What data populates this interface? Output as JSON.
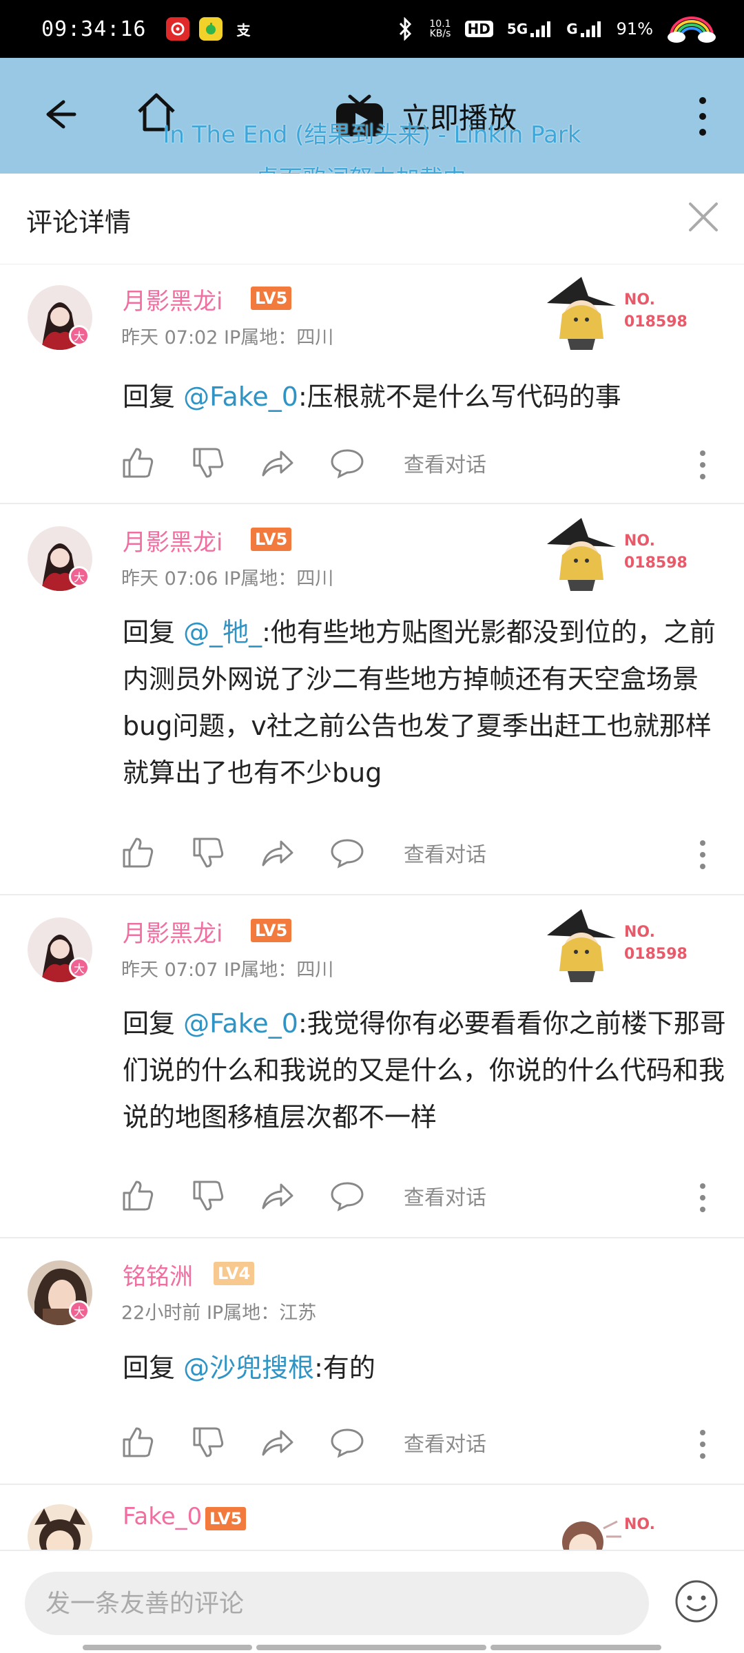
{
  "status_bar": {
    "time": "09:34:16",
    "app_icons": [
      "netease-music-icon",
      "qq-music-icon",
      "alipay-icon"
    ],
    "alipay_glyph": "支",
    "net_speed_top": "10.1",
    "net_speed_bottom": "KB/s",
    "hd": "HD",
    "signal_5g": "5G",
    "signal_g": "G",
    "battery": "91%"
  },
  "app_bar": {
    "play_now_label": "立即播放",
    "lyric_line1": "In The End (结果到头来) - Linkin Park",
    "lyric_line2": "桌面歌词努力加载中..."
  },
  "header": {
    "title": "评论详情"
  },
  "pendant_text": {
    "no": "NO.",
    "num": "018598"
  },
  "comments": [
    {
      "user": "月影黑龙i",
      "level": "LV5",
      "time": "昨天 07:02",
      "ip": "IP属地：四川",
      "reply_prefix": "回复",
      "mention": "@Fake_0",
      "text": ":压根就不是什么写代码的事",
      "view_conversation": "查看对话"
    },
    {
      "user": "月影黑龙i",
      "level": "LV5",
      "time": "昨天 07:06",
      "ip": "IP属地：四川",
      "reply_prefix": "回复",
      "mention": "@_牠_",
      "text": ":他有些地方贴图光影都没到位的，之前内测员外网说了沙二有些地方掉帧还有天空盒场景bug问题，v社之前公告也发了夏季出赶工也就那样就算出了也有不少bug",
      "view_conversation": "查看对话"
    },
    {
      "user": "月影黑龙i",
      "level": "LV5",
      "time": "昨天 07:07",
      "ip": "IP属地：四川",
      "reply_prefix": "回复",
      "mention": "@Fake_0",
      "text": ":我觉得你有必要看看你之前楼下那哥们说的什么和我说的又是什么，你说的什么代码和我说的地图移植层次都不一样",
      "view_conversation": "查看对话"
    },
    {
      "user": "铭铭洲",
      "level": "LV4",
      "time": "22小时前",
      "ip": "IP属地：江苏",
      "reply_prefix": "回复",
      "mention": "@沙兜搜根",
      "text": ":有的",
      "view_conversation": "查看对话"
    },
    {
      "user": "Fake_0",
      "level": "LV5"
    }
  ],
  "avatar_badge": "大",
  "bottom": {
    "placeholder": "发一条友善的评论"
  },
  "colors": {
    "appbar": "#98c8e3",
    "username": "#f06fa0",
    "mention": "#2f93c4",
    "lv5": "#f17a3c",
    "lv4": "#f8c98f"
  }
}
